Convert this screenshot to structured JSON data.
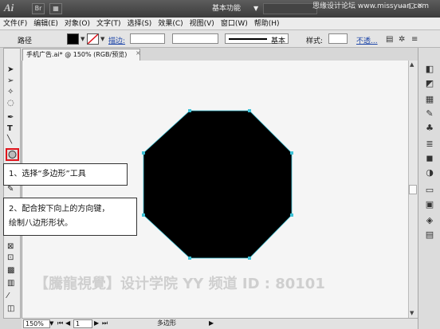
{
  "app": {
    "logo": "Ai",
    "workspace": "基本功能",
    "watermark_top": "思缘设计论坛 www.missyuan.com",
    "window_controls": "— ▢ ✕"
  },
  "menu": [
    "文件(F)",
    "编辑(E)",
    "对象(O)",
    "文字(T)",
    "选择(S)",
    "效果(C)",
    "视图(V)",
    "窗口(W)",
    "帮助(H)"
  ],
  "control_bar": {
    "path_label": "路径",
    "stroke_label": "描边:",
    "basic_label": "基本",
    "style_label": "样式:",
    "opacity_label": "不透..."
  },
  "document_tab": {
    "title": "手机广告.ai* @ 150% (RGB/预览)",
    "close": "×"
  },
  "status_bar": {
    "zoom": "150%",
    "page": "1",
    "info": "多边形"
  },
  "callouts": {
    "step1": "1、选择“多边形”工具",
    "step2_line1": "2、配合按下向上的方向键，",
    "step2_line2": "绘制八边形形状。"
  },
  "canvas_watermark": "【騰龍視覺】设计学院  YY 频道 ID : 80101",
  "colors": {
    "shape_fill": "#000000",
    "anchor_color": "#3fc3d8",
    "highlight_red": "#e0141c"
  }
}
